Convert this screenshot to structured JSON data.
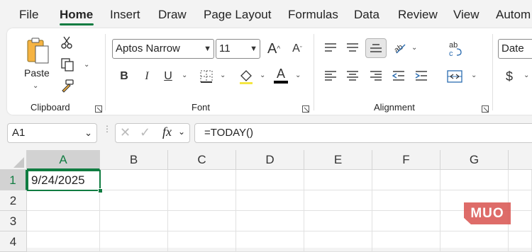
{
  "menu": {
    "tabs": [
      "File",
      "Home",
      "Insert",
      "Draw",
      "Page Layout",
      "Formulas",
      "Data",
      "Review",
      "View",
      "Autom"
    ],
    "active": "Home"
  },
  "clipboard": {
    "paste_label": "Paste",
    "group_label": "Clipboard"
  },
  "font": {
    "name": "Aptos Narrow",
    "size": "11",
    "group_label": "Font"
  },
  "alignment": {
    "group_label": "Alignment"
  },
  "number": {
    "format": "Date",
    "currency_symbol": "$"
  },
  "formula_bar": {
    "name_box": "A1",
    "fx": "fx",
    "formula": "=TODAY()"
  },
  "sheet": {
    "columns": [
      "A",
      "B",
      "C",
      "D",
      "E",
      "F",
      "G"
    ],
    "rows": [
      "1",
      "2",
      "3",
      "4"
    ],
    "a1_value": "9/24/2025",
    "active_cell": "A1"
  },
  "watermark": "MUO",
  "colors": {
    "accent": "#107c41",
    "watermark": "#d9534f"
  }
}
